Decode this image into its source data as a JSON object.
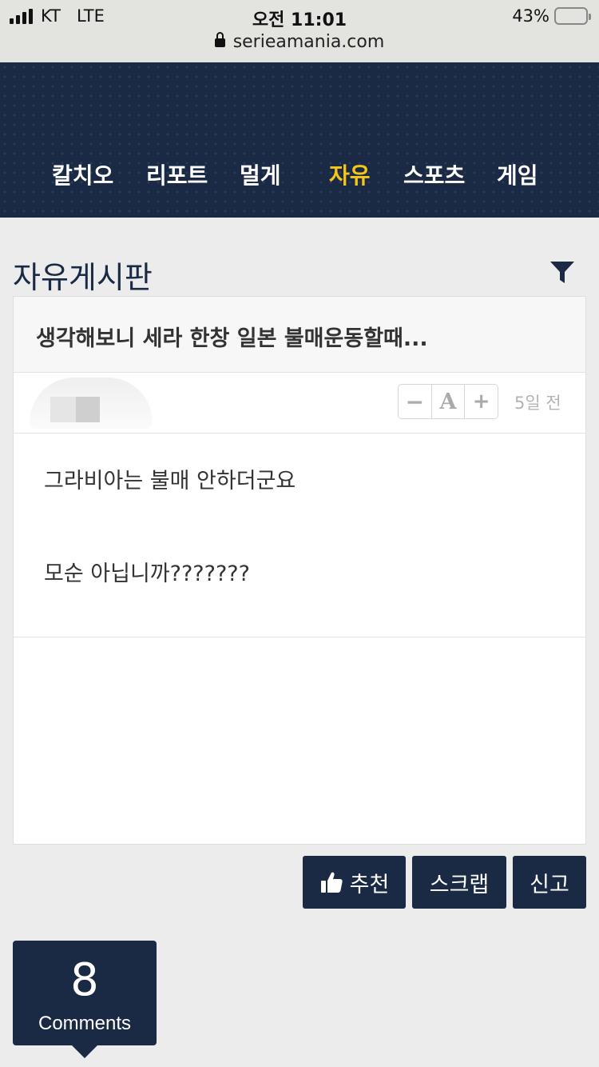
{
  "status_bar": {
    "carrier": "KT",
    "network": "LTE",
    "time": "오전 11:01",
    "battery": "43%",
    "battery_level": 0.43,
    "url": "serieamania.com"
  },
  "nav": {
    "items": [
      {
        "label": "칼치오",
        "active": false
      },
      {
        "label": "리포트",
        "active": false
      },
      {
        "label": "멀게",
        "active": false
      },
      {
        "label": "자유",
        "active": true
      },
      {
        "label": "스포츠",
        "active": false
      },
      {
        "label": "게임",
        "active": false
      }
    ]
  },
  "board": {
    "title": "자유게시판",
    "filter_icon": "funnel-filter-icon"
  },
  "post": {
    "title": "생각해보니 세라 한창 일본 불매운동할때...",
    "date": "5일 전",
    "font_controls": {
      "decrease": "−",
      "font": "A",
      "increase": "+"
    },
    "body": [
      "그라비아는 불매 안하더군요",
      "모순 아닙니까???????"
    ]
  },
  "actions": {
    "recommend": "추천",
    "scrap": "스크랩",
    "report": "신고",
    "recommend_icon": "thumbs-up-icon"
  },
  "comments": {
    "count": "8",
    "label": "Comments"
  },
  "colors": {
    "navy": "#1b2a44",
    "active_nav": "#f5c518",
    "background": "#ececec"
  }
}
